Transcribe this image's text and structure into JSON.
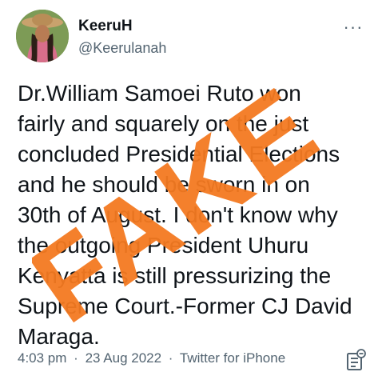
{
  "author": {
    "display_name": "KeeruH",
    "handle": "@Keerulanah"
  },
  "tweet": {
    "lines": [
      "Dr.William Samoei Ruto won",
      "fairly and squarely on the just",
      "concluded Presidential Elections",
      "and he should be sworn in on",
      "30th of August. I don't know why",
      "the outgoing President Uhuru",
      "Kenyatta is still pressurizing the",
      "Supreme Court.-Former CJ David",
      "Maraga."
    ]
  },
  "overlay": {
    "stamp_text": "FAKE",
    "color": "#f47a21"
  },
  "meta": {
    "time": "4:03 pm",
    "date": "23 Aug 2022",
    "source": "Twitter for iPhone",
    "separator": "·"
  },
  "icons": {
    "more": "more-options-icon",
    "analytics": "analytics-icon",
    "avatar": "avatar-photo"
  }
}
